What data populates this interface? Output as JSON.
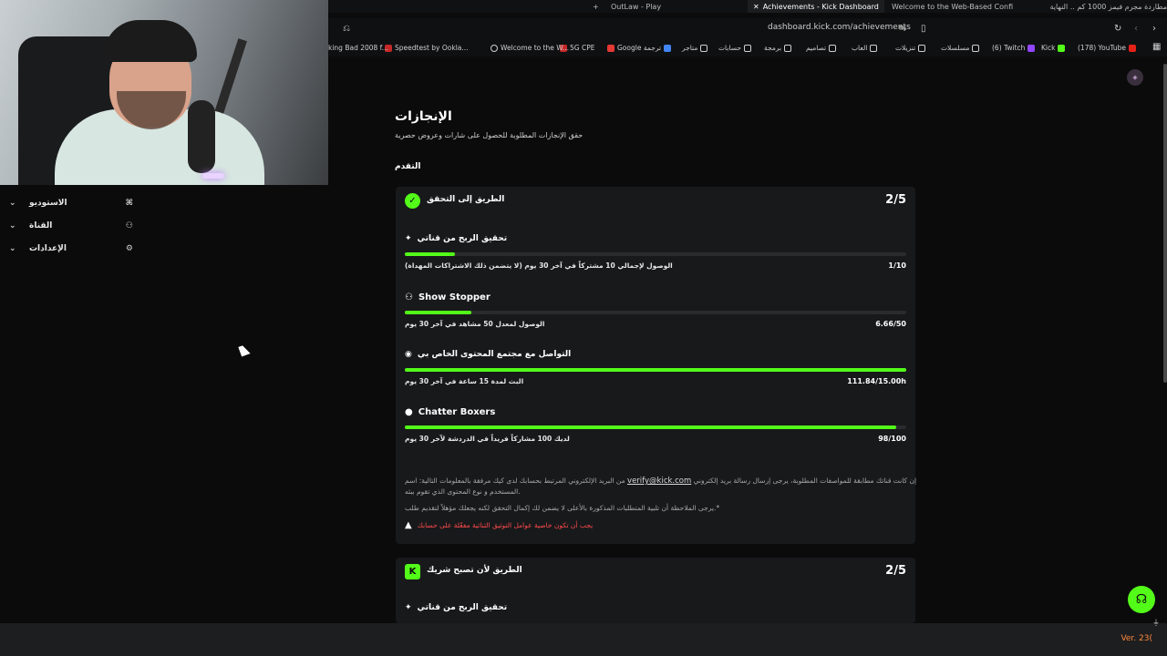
{
  "browser": {
    "tabs": [
      {
        "label": "OutLaw - Play",
        "active": false
      },
      {
        "label": "Achievements - Kick Dashboard",
        "active": true
      },
      {
        "label": "Welcome to the Web-Based Confi",
        "active": false
      },
      {
        "label": "مطاردة مجرم فيمز 1000 كم .. النهاية",
        "active": false
      }
    ],
    "url": "dashboard.kick.com/achievements",
    "bookmarks": [
      "(178) YouTube",
      "Kick",
      "(6) Twitch",
      "مسلسلات",
      "تنزيلات",
      "العاب",
      "تصاميم",
      "برمجة",
      "حسابات",
      "متاجر",
      "Google ترجمة",
      "5G CPE",
      "Welcome to the W...",
      "Speedtest by Ookla...",
      "king Bad 2008 f..."
    ]
  },
  "sidebar": {
    "items": [
      {
        "label": "الاستوديو",
        "icon": "studio-icon"
      },
      {
        "label": "القناة",
        "icon": "channel-icon"
      },
      {
        "label": "الإعدادات",
        "icon": "gear-icon"
      }
    ]
  },
  "page": {
    "title": "الإنجازات",
    "subtitle": "حقق الإنجازات المطلوبة للحصول على شارات وعروض حصرية",
    "section": "التقدم"
  },
  "cards": [
    {
      "title": "الطريق إلى التحقق",
      "count": "2/5",
      "achievements": [
        {
          "name": "تحقيق الربح من قناتي",
          "desc": "الوصول لإجمالي 10 مشتركاً في آخر 30 يوم (لا يتضمن ذلك الاشتراكات المهداة)",
          "progress": "1/10",
          "fraction": 0.1,
          "icon": "sparkle-icon"
        },
        {
          "name": "Show Stopper",
          "desc": "الوصول لمعدل 50 مشاهد في آخر 30 يوم",
          "progress": "6.66/50",
          "fraction": 0.133,
          "icon": "users-icon"
        },
        {
          "name": "التواصل مع مجتمع المحتوى الخاص بي",
          "desc": "البث لمدة 15 ساعة في آخر 30 يوم",
          "progress": "111.84/15.00h",
          "fraction": 1.0,
          "icon": "broadcast-icon"
        },
        {
          "name": "Chatter Boxers",
          "desc": "لديك 100 مشاركاً فريداً في الدردشة لآخر 30 يوم",
          "progress": "98/100",
          "fraction": 0.98,
          "icon": "chat-icon"
        }
      ],
      "notes": {
        "line1_pre": "إن كانت قناتك مطابقة للمواصفات المطلوبة، يرجى إرسال رسالة بريد إلكتروني",
        "email": "verify@kick.com",
        "line1_post": "من البريد الإلكتروني المرتبط بحسابك لدى كيك مرفقة بالمعلومات التالية: اسم",
        "line2": "المستخدم و نوع المحتوى الذي تقوم ببثه.",
        "line3": "يرجى الملاحظة أن تلبية المتطلبات المذكورة بالأعلى لا يضمن لك إكمال التحقق لكنه يجعلك مؤهلاً لتقديم طلب.*",
        "warning": "يجب أن تكون خاصية عوامل التوثيق الثنائية مفعّلة على حسابك"
      }
    },
    {
      "title": "الطريق لأن تصبح شريك",
      "count": "2/5",
      "achievements": [
        {
          "name": "تحقيق الربح من قناتي",
          "icon": "sparkle-icon"
        }
      ]
    }
  ],
  "footer": {
    "version": "Ver. 23("
  },
  "colors": {
    "accent": "#53fc18",
    "warning": "#ff4b4b",
    "background": "#0b0b0c",
    "card": "#18191b"
  }
}
